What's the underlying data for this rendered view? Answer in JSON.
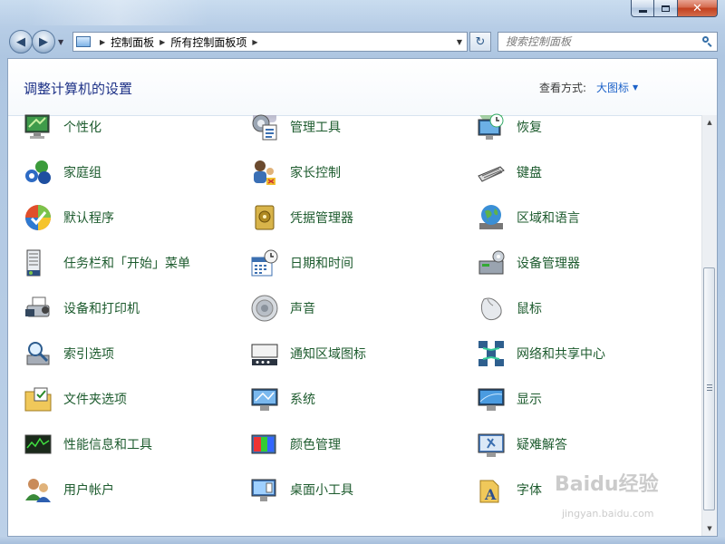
{
  "window": {
    "minimize_label": "",
    "maximize_label": "",
    "close_label": "✕"
  },
  "nav": {
    "back_icon": "back-arrow-icon",
    "forward_icon": "forward-arrow-icon"
  },
  "address": {
    "crumbs": [
      "控制面板",
      "所有控制面板项"
    ]
  },
  "search": {
    "placeholder": "搜索控制面板"
  },
  "header": {
    "title": "调整计算机的设置",
    "view_label": "查看方式:",
    "view_mode": "大图标"
  },
  "items": [
    {
      "label": "个性化",
      "icon": "personalization-icon"
    },
    {
      "label": "管理工具",
      "icon": "admin-tools-icon"
    },
    {
      "label": "恢复",
      "icon": "recovery-icon"
    },
    {
      "label": "家庭组",
      "icon": "homegroup-icon"
    },
    {
      "label": "家长控制",
      "icon": "parental-controls-icon"
    },
    {
      "label": "键盘",
      "icon": "keyboard-icon"
    },
    {
      "label": "默认程序",
      "icon": "default-programs-icon"
    },
    {
      "label": "凭据管理器",
      "icon": "credential-manager-icon"
    },
    {
      "label": "区域和语言",
      "icon": "region-language-icon"
    },
    {
      "label": "任务栏和「开始」菜单",
      "icon": "taskbar-start-icon"
    },
    {
      "label": "日期和时间",
      "icon": "date-time-icon"
    },
    {
      "label": "设备管理器",
      "icon": "device-manager-icon"
    },
    {
      "label": "设备和打印机",
      "icon": "devices-printers-icon"
    },
    {
      "label": "声音",
      "icon": "sound-icon"
    },
    {
      "label": "鼠标",
      "icon": "mouse-icon"
    },
    {
      "label": "索引选项",
      "icon": "indexing-options-icon"
    },
    {
      "label": "通知区域图标",
      "icon": "notification-area-icon"
    },
    {
      "label": "网络和共享中心",
      "icon": "network-sharing-icon"
    },
    {
      "label": "文件夹选项",
      "icon": "folder-options-icon"
    },
    {
      "label": "系统",
      "icon": "system-icon"
    },
    {
      "label": "显示",
      "icon": "display-icon"
    },
    {
      "label": "性能信息和工具",
      "icon": "performance-icon"
    },
    {
      "label": "颜色管理",
      "icon": "color-management-icon"
    },
    {
      "label": "疑难解答",
      "icon": "troubleshooting-icon"
    },
    {
      "label": "用户帐户",
      "icon": "user-accounts-icon"
    },
    {
      "label": "桌面小工具",
      "icon": "desktop-gadgets-icon"
    },
    {
      "label": "字体",
      "icon": "fonts-icon"
    }
  ],
  "watermark": {
    "brand": "Baidu经验",
    "url": "jingyan.baidu.com"
  },
  "colors": {
    "link": "#1d5b2e",
    "title": "#1e3287",
    "accent": "#1c62c9"
  }
}
